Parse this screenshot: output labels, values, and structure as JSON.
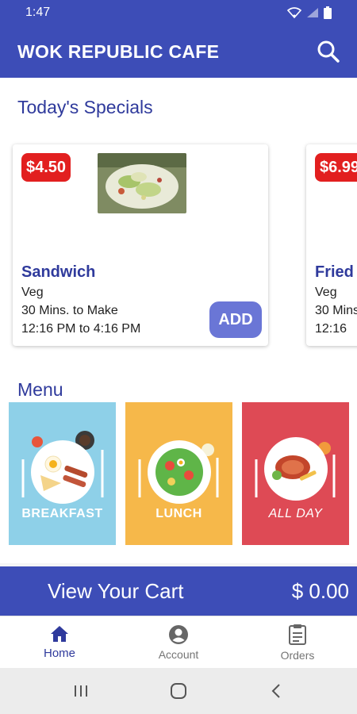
{
  "status_bar": {
    "time": "1:47"
  },
  "app_bar": {
    "title": "WOK REPUBLIC CAFE",
    "search_icon": "search-icon"
  },
  "specials": {
    "title": "Today's Specials",
    "cards": [
      {
        "price": "$4.50",
        "name": "Sandwich",
        "type": "Veg",
        "prep_time": "30 Mins. to Make",
        "availability": "12:16 PM to 4:16 PM",
        "add_label": "ADD"
      },
      {
        "price": "$6.99",
        "name": "Fried",
        "type": "Veg",
        "prep_time": "30 Mins",
        "availability": "12:16"
      }
    ]
  },
  "menu": {
    "title": "Menu",
    "categories": [
      {
        "label": "BREAKFAST",
        "color": "#8ed0e8"
      },
      {
        "label": "LUNCH",
        "color": "#f6b84a"
      },
      {
        "label": "ALL DAY",
        "color": "#de4a55"
      }
    ]
  },
  "cart": {
    "label": "View Your Cart",
    "total": "$ 0.00"
  },
  "bottom_nav": {
    "items": [
      {
        "label": "Home",
        "icon": "home-icon",
        "active": true
      },
      {
        "label": "Account",
        "icon": "account-icon",
        "active": false
      },
      {
        "label": "Orders",
        "icon": "orders-icon",
        "active": false
      }
    ]
  },
  "colors": {
    "primary": "#3d4db7",
    "accent_button": "#6a76d6",
    "price_badge": "#e21f1f",
    "title_text": "#2f3a9c"
  }
}
